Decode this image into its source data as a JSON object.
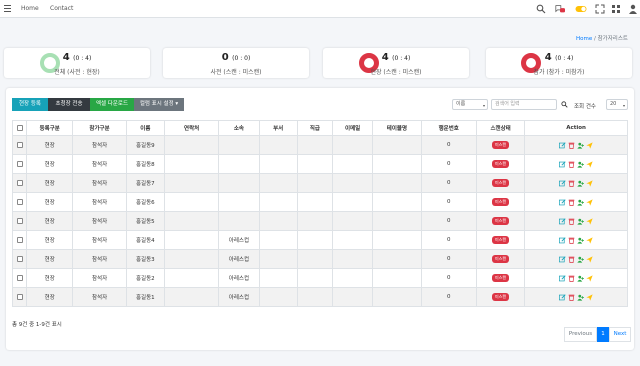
{
  "nav": {
    "home": "Home",
    "contact": "Contact",
    "notif_count": "1"
  },
  "breadcrumb": {
    "home": "Home",
    "sep": "/",
    "current": "참가자리스트"
  },
  "stats": [
    {
      "value": "4",
      "detail": "(0 : 4)",
      "label": "전체 (사전 : 현장)",
      "color": "#a8e0b4"
    },
    {
      "value": "0",
      "detail": "(0 : 0)",
      "label": "사전 (스캔 : 미스캔)",
      "color": ""
    },
    {
      "value": "4",
      "detail": "(0 : 4)",
      "label": "현장 (스캔 : 미스캔)",
      "color": "#dc3545"
    },
    {
      "value": "4",
      "detail": "(0 : 4)",
      "label": "참가 (참가 : 미참가)",
      "color": "#dc3545"
    }
  ],
  "toolbar": {
    "register": "현장 등록",
    "invite": "초청장 전송",
    "excel": "엑셀 다운로드",
    "columns": "컬럼 표시 설정 ▾",
    "search_field": "이름",
    "search_placeholder": "검색어 입력",
    "page_size_label": "조회 건수",
    "page_size": "20"
  },
  "table": {
    "headers": [
      "등록구분",
      "참가구분",
      "이름",
      "연락처",
      "소속",
      "부서",
      "직급",
      "이메일",
      "테이블명",
      "행운번호",
      "스캔상태",
      "Action"
    ],
    "rows": [
      {
        "reg": "현장",
        "type": "참석자",
        "name": "홍길동9",
        "contact": "",
        "org": "",
        "lucky": "0",
        "status": "미스캔"
      },
      {
        "reg": "현장",
        "type": "참석자",
        "name": "홍길동8",
        "contact": "",
        "org": "",
        "lucky": "0",
        "status": "미스캔"
      },
      {
        "reg": "현장",
        "type": "참석자",
        "name": "홍길동7",
        "contact": "",
        "org": "",
        "lucky": "0",
        "status": "미스캔"
      },
      {
        "reg": "현장",
        "type": "참석자",
        "name": "홍길동6",
        "contact": "",
        "org": "",
        "lucky": "0",
        "status": "미스캔"
      },
      {
        "reg": "현장",
        "type": "참석자",
        "name": "홍길동5",
        "contact": "",
        "org": "",
        "lucky": "0",
        "status": "미스캔"
      },
      {
        "reg": "현장",
        "type": "참석자",
        "name": "홍길동4",
        "contact": "",
        "org": "아레스컵",
        "lucky": "0",
        "status": "미스캔"
      },
      {
        "reg": "현장",
        "type": "참석자",
        "name": "홍길동3",
        "contact": "",
        "org": "아레스컵",
        "lucky": "0",
        "status": "미스캔"
      },
      {
        "reg": "현장",
        "type": "참석자",
        "name": "홍길동2",
        "contact": "",
        "org": "아레스컵",
        "lucky": "0",
        "status": "미스캔"
      },
      {
        "reg": "현장",
        "type": "참석자",
        "name": "홍길동1",
        "contact": "",
        "org": "아레스컵",
        "lucky": "0",
        "status": "미스캔"
      }
    ]
  },
  "footer": {
    "info": "총 9건 중 1-9건 표시",
    "prev": "Previous",
    "page": "1",
    "next": "Next"
  }
}
